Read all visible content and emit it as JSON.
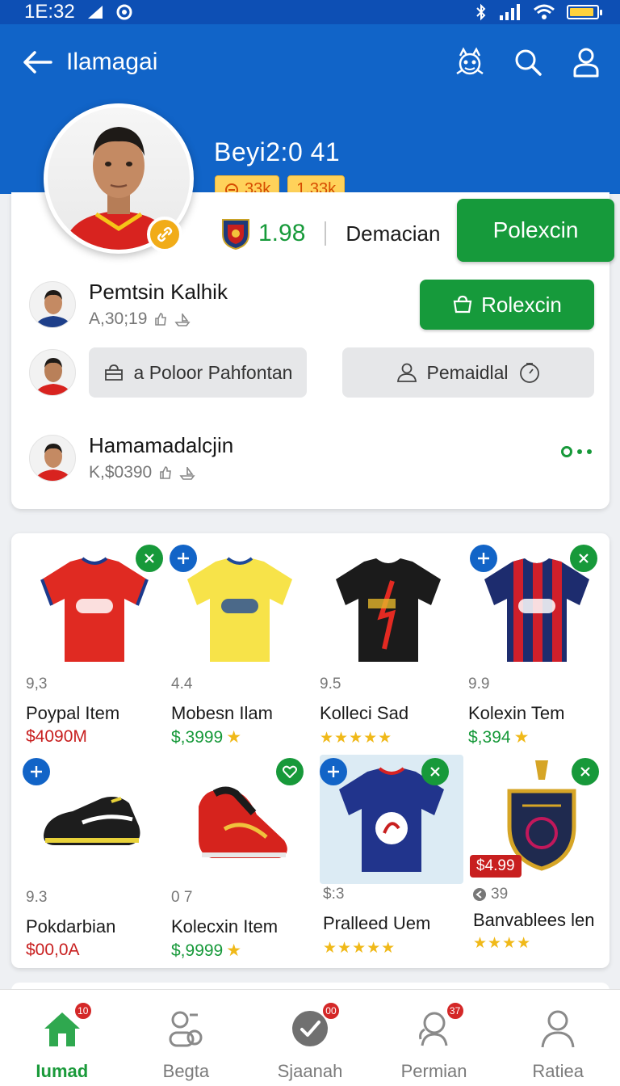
{
  "status_bar": {
    "time": "1E:32",
    "battery_level": 0.9
  },
  "header": {
    "title": "Ilamagai"
  },
  "profile": {
    "name": "Beyi2:0 41",
    "stats": [
      "33k",
      "1.33k"
    ],
    "rating": "1.98",
    "rating_label": "Demacian",
    "primary_action": "Polexcin"
  },
  "friends": [
    {
      "name": "Pemtsin Kalhik",
      "sub": "A,30;19"
    },
    {
      "name": "",
      "sub": ""
    },
    {
      "name": "Hamamadalcjin",
      "sub": "K,$0390"
    }
  ],
  "actions": {
    "secondary": "Rolexcin",
    "pill_left": "a Poloor Pahfontan",
    "pill_right": "Pemaidlal"
  },
  "items": [
    {
      "score": "9,3",
      "name": "Poypal Item",
      "price": "$4090M",
      "price_color": "#c81f1f",
      "corner": "close"
    },
    {
      "score": "4.4",
      "name": "Mobesn Ilam",
      "price": "$,3999",
      "price_color": "#17993a",
      "corner": "add",
      "star": true
    },
    {
      "score": "9.5",
      "name": "Kolleci Sad",
      "stars": "★★★★★",
      "corner": "none"
    },
    {
      "score": "9.9",
      "name": "Kolexin Tem",
      "price": "$,394",
      "price_color": "#17993a",
      "corner": "both",
      "star": true
    },
    {
      "score": "9.3",
      "name": "Pokdarbian",
      "price": "$00,0A",
      "price_color": "#c81f1f",
      "corner": "add"
    },
    {
      "score": "0 7",
      "name": "Kolecxin Item",
      "price": "$,9999",
      "price_color": "#17993a",
      "corner": "heart",
      "star": true
    },
    {
      "score": "$:3",
      "name": "Pralleed Uem",
      "stars": "★★★★★",
      "corner": "both"
    },
    {
      "score": "39",
      "name": "Banvablees len",
      "stars": "★★★★",
      "corner": "close",
      "tag": "$4.99"
    }
  ],
  "nav": [
    {
      "label": "Iumad",
      "badge": "10",
      "active": true
    },
    {
      "label": "Begta",
      "badge": ""
    },
    {
      "label": "Sjaanah",
      "badge": "00"
    },
    {
      "label": "Permian",
      "badge": "37"
    },
    {
      "label": "Ratiea",
      "badge": ""
    }
  ],
  "colors": {
    "primary_blue": "#1164c8",
    "accent_green": "#169a3b",
    "price_red": "#c81f1f",
    "star_gold": "#f0b919"
  }
}
